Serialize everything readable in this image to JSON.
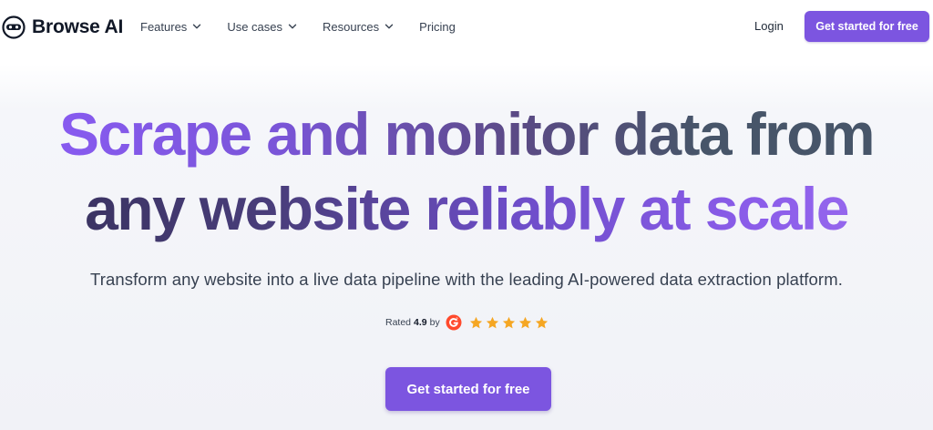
{
  "brand": {
    "name": "Browse AI",
    "logo_icon": "robot-head-icon"
  },
  "nav": {
    "items": [
      {
        "label": "Features",
        "has_dropdown": true
      },
      {
        "label": "Use cases",
        "has_dropdown": true
      },
      {
        "label": "Resources",
        "has_dropdown": true
      },
      {
        "label": "Pricing",
        "has_dropdown": false
      }
    ],
    "login_label": "Login",
    "cta_label": "Get started for free"
  },
  "hero": {
    "title_line_1": "Scrape and monitor data from",
    "title_line_2": "any website reliably at scale",
    "subtitle": "Transform any website into a live data pipeline with the leading AI-powered data extraction platform.",
    "rating": {
      "prefix": "Rated",
      "score": "4.9",
      "by": "by",
      "source_icon": "g2-logo-icon",
      "stars": 5
    },
    "cta_label": "Get started for free"
  },
  "colors": {
    "accent": "#7c55e0",
    "star": "#f5a623",
    "g2": "#ff492c"
  }
}
